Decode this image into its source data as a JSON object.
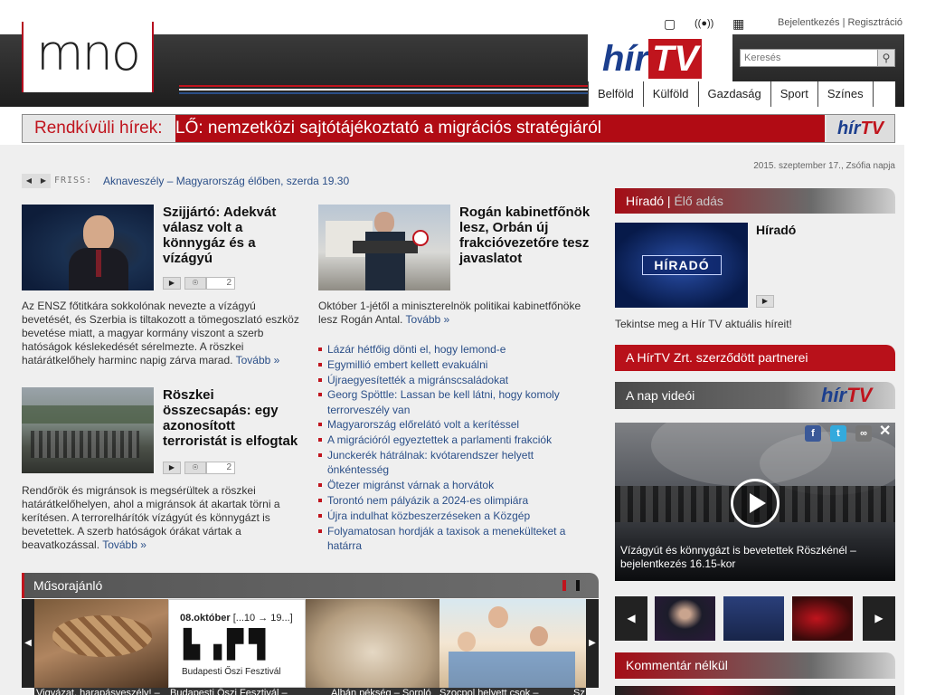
{
  "header": {
    "logo_text": "mno",
    "hirtv_a": "hír",
    "hirtv_b": "TV",
    "login": "Bejelentkezés",
    "separator": "|",
    "register": "Regisztráció",
    "search_placeholder": "Keresés",
    "nav": [
      "Belföld",
      "Külföld",
      "Gazdaság",
      "Sport",
      "Színes"
    ]
  },
  "breaking": {
    "label": "Rendkívüli hírek:",
    "text": "LŐ: nemzetközi sajtótájékoztató a migrációs stratégiáról"
  },
  "ticker": {
    "label": "FRISS:",
    "text": "Aknaveszély – Magyarország élőben, szerda 19.30"
  },
  "date": "2015. szeptember 17., Zsófia napja",
  "articles": {
    "a1": {
      "title": "Szijjártó: Adekvát válasz volt a könnygáz és a vízágyú",
      "comments": "2",
      "text": "Az ENSZ főtitkára sokkolónak nevezte a vízágyú bevetését, és Szerbia is tiltakozott a tömegoszlató eszköz bevetése miatt, a magyar kormány viszont a szerb hatóságok késlekedését sérelmezte. A röszkei határátkelőhely harminc napig zárva marad.",
      "more": "Tovább »"
    },
    "a2": {
      "title": "Rogán kabinetfőnök lesz, Orbán új frakcióvezetőre tesz javaslatot",
      "text": "Október 1-jétől a miniszterelnök politikai kabinetfőnöke lesz Rogán Antal.",
      "more": "Tovább »"
    },
    "a3": {
      "title": "Röszkei összecsapás: egy azonosított terroristát is elfogtak",
      "comments": "2",
      "text": "Rendőrök és migránsok is megsérültek a röszkei határátkelőhelyen, ahol a migránsok át akartak törni a kerítésen. A terrorelhárítók vízágyút és könnygázt is bevetettek. A szerb hatóságok órákat vártak a beavatkozással.",
      "more": "Tovább »"
    }
  },
  "links": [
    "Lázár hétfőig dönti el, hogy lemond-e",
    "Egymillió embert kellett evakuálni",
    "Újraegyesítették a migránscsaládokat",
    "Georg Spöttle: Lassan be kell látni, hogy komoly terrorveszély van",
    "Magyarország előrelátó volt a kerítéssel",
    "A migrációról egyeztettek a parlamenti frakciók",
    "Junckerék hátrálnak: kvótarendszer helyett önkéntesség",
    "Ötezer migránst várnak a horvátok",
    "Torontó nem pályázik a 2024-es olimpiára",
    "Újra indulhat közbeszerzéseken a Közgép",
    "Folyamatosan hordják a taxisok a menekülteket a határra"
  ],
  "right": {
    "hirado_head": "Híradó",
    "hirado_sep": " | ",
    "hirado_live": "Élő adás",
    "hirado_badge": "HÍRADÓ",
    "hirado_title": "Híradó",
    "hirado_desc": "Tekintse meg a Hír TV aktuális híreit!",
    "partners": "A HírTV Zrt. szerződött partnerei",
    "nap_videoi": "A nap videói",
    "video_caption": "Vízágyút és könnygázt is bevetettek Röszkénél – bejelentkezés 16.15-kor",
    "komentar": "Kommentár nélkül"
  },
  "musor": {
    "title": "Műsorajánló",
    "boef_date": "08.október",
    "boef_range": "[...10 → 19...]",
    "boef_name": "Budapesti Őszi Fesztivál",
    "captions": [
      "Vigyázat, harapásveszély! –",
      "Budapesti Őszi Fesztivál –",
      "Albán pékség – Sorpló",
      "Szocpol helyett csok –",
      "Sz"
    ]
  }
}
